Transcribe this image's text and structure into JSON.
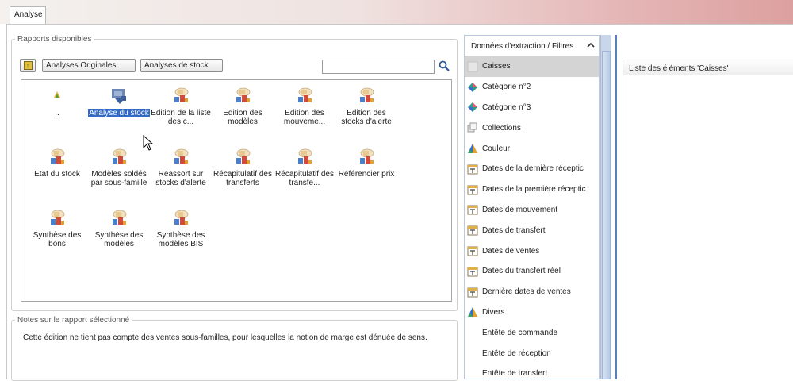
{
  "tab": {
    "label": "Analyse"
  },
  "rapports": {
    "legend": "Rapports disponibles",
    "buttons": {
      "originales": "Analyses Originales",
      "stock": "Analyses de stock"
    },
    "search": {
      "value": "",
      "placeholder": ""
    },
    "items": [
      {
        "label": "..",
        "icon": "up-folder-icon"
      },
      {
        "label": "Analyse du stock",
        "icon": "stock-analysis-icon",
        "selected": true
      },
      {
        "label": "Edition de la liste des c...",
        "icon": "report-icon"
      },
      {
        "label": "Edition des modèles",
        "icon": "report-icon"
      },
      {
        "label": "Edition des mouveme...",
        "icon": "report-icon"
      },
      {
        "label": "Edition des stocks d'alerte",
        "icon": "report-icon"
      },
      {
        "label": "Etat du stock",
        "icon": "report-icon"
      },
      {
        "label": "Modèles soldés par sous-famille",
        "icon": "report-icon"
      },
      {
        "label": "Réassort sur stocks d'alerte",
        "icon": "report-icon"
      },
      {
        "label": "Récapitulatif des transferts",
        "icon": "report-icon"
      },
      {
        "label": "Récapitulatif des transfe...",
        "icon": "report-icon"
      },
      {
        "label": "Référencier prix",
        "icon": "report-icon"
      },
      {
        "label": "Synthèse des bons",
        "icon": "report-icon"
      },
      {
        "label": "Synthèse des modèles",
        "icon": "report-icon"
      },
      {
        "label": "Synthèse des modèles BIS",
        "icon": "report-icon"
      }
    ]
  },
  "notes": {
    "legend": "Notes sur le rapport sélectionné",
    "text": "Cette édition ne tient pas compte des ventes sous-familles, pour lesquelles la notion de marge est dénuée de sens."
  },
  "filters": {
    "title": "Données d'extraction / Filtres",
    "items": [
      {
        "label": "Caisses",
        "icon": "blank-icon",
        "selected": true
      },
      {
        "label": "Catégorie n°2",
        "icon": "diamond-icon"
      },
      {
        "label": "Catégorie n°3",
        "icon": "diamond-icon"
      },
      {
        "label": "Collections",
        "icon": "collection-icon"
      },
      {
        "label": "Couleur",
        "icon": "triangle-icon"
      },
      {
        "label": "Dates de la dernière réceptic",
        "icon": "calendar-icon"
      },
      {
        "label": "Dates de la première réceptic",
        "icon": "calendar-icon"
      },
      {
        "label": "Dates de mouvement",
        "icon": "calendar-icon"
      },
      {
        "label": "Dates de transfert",
        "icon": "calendar-icon"
      },
      {
        "label": "Dates de ventes",
        "icon": "calendar-icon"
      },
      {
        "label": "Dates du transfert réel",
        "icon": "calendar-icon"
      },
      {
        "label": "Dernière dates de ventes",
        "icon": "calendar-icon"
      },
      {
        "label": "Divers",
        "icon": "triangle-icon"
      },
      {
        "label": "Entête de commande",
        "icon": "none"
      },
      {
        "label": "Entête de réception",
        "icon": "none"
      },
      {
        "label": "Entête de transfert",
        "icon": "none"
      }
    ]
  },
  "list": {
    "header": "Liste des éléments 'Caisses'"
  },
  "colors": {
    "selection": "#316ac5",
    "accent_line": "#5a7fbf",
    "tab_gradient_end": "#dda0a0"
  }
}
